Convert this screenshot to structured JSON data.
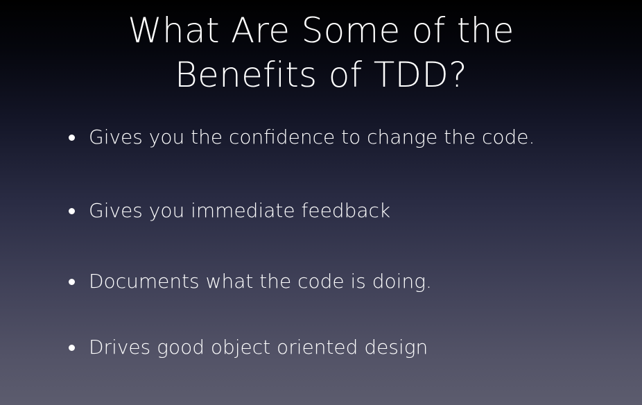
{
  "slide": {
    "title_line1": "What Are Some of the",
    "title_line2": "Benefits of TDD?",
    "bullets": [
      {
        "text": "Gives you the confidence to change the code."
      },
      {
        "text": "Gives you immediate feedback"
      },
      {
        "text": "Documents what the code is doing."
      },
      {
        "text": "Drives good object oriented design"
      }
    ]
  }
}
